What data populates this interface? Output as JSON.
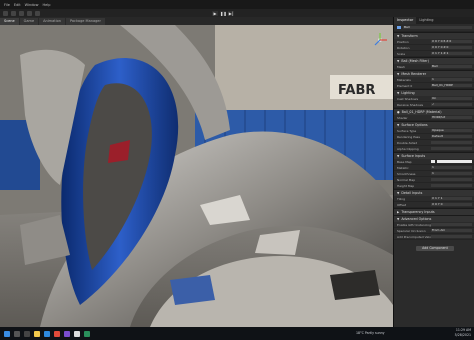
{
  "menu": {
    "items": [
      "File",
      "Edit",
      "Window",
      "Help"
    ]
  },
  "scene_tabs": [
    "Scene",
    "Game",
    "Animation",
    "Package Manager"
  ],
  "viewport": {
    "sign_text": "FABR"
  },
  "inspector": {
    "tabs": [
      "Inspector",
      "Lighting"
    ],
    "object_name": "Ball",
    "transform_title": "Transform",
    "transform_rows": [
      {
        "label": "Position",
        "value": "X 0  Y 0.5  Z 0"
      },
      {
        "label": "Rotation",
        "value": "X 0  Y 0  Z 0"
      },
      {
        "label": "Scale",
        "value": "X 1  Y 1  Z 1"
      }
    ],
    "mesh_filter_title": "Ball (Mesh Filter)",
    "mesh_row": {
      "label": "Mesh",
      "value": "Ball"
    },
    "renderer_title": "Mesh Renderer",
    "renderer_rows": [
      {
        "label": "Materials",
        "value": "1"
      },
      {
        "label": "Element 0",
        "value": "Ball_01_HDRP"
      }
    ],
    "lighting_title": "Lighting",
    "lighting_rows": [
      {
        "label": "Cast Shadows",
        "value": "On"
      },
      {
        "label": "Receive Shadows",
        "value": "✓"
      }
    ],
    "material_title": "Ball_01_HDRP (Material)",
    "shader_row": {
      "label": "Shader",
      "value": "HDRP/Lit"
    },
    "surface_title": "Surface Options",
    "surface_rows": [
      {
        "label": "Surface Type",
        "value": "Opaque"
      },
      {
        "label": "Rendering Pass",
        "value": "Default"
      },
      {
        "label": "Double-Sided",
        "value": ""
      },
      {
        "label": "Alpha Clipping",
        "value": ""
      }
    ],
    "inputs_title": "Surface Inputs",
    "input_rows": [
      {
        "label": "Base Map",
        "value": ""
      },
      {
        "label": "Metallic",
        "value": "1"
      },
      {
        "label": "Smoothness",
        "value": "1"
      },
      {
        "label": "Normal Map",
        "value": ""
      },
      {
        "label": "Height Map",
        "value": ""
      }
    ],
    "detail_title": "Detail Inputs",
    "tiling_rows": [
      {
        "label": "Tiling",
        "value": "X 1  Y 1"
      },
      {
        "label": "Offset",
        "value": "X 0  Y 0"
      }
    ],
    "transparency_title": "Transparency Inputs",
    "advanced_title": "Advanced Options",
    "advanced_rows": [
      {
        "label": "Enable GPU Instancing",
        "value": ""
      },
      {
        "label": "Specular Occlusion",
        "value": "From AO"
      },
      {
        "label": "Add Precomputed Velocity",
        "value": ""
      }
    ],
    "add_component_label": "Add Component"
  },
  "taskbar": {
    "weather": "18°C  Partly sunny",
    "time": "11:29 AM",
    "date": "5/28/2021"
  },
  "colors": {
    "accent": "#3a72c4",
    "taskbar": "#0f1216"
  }
}
